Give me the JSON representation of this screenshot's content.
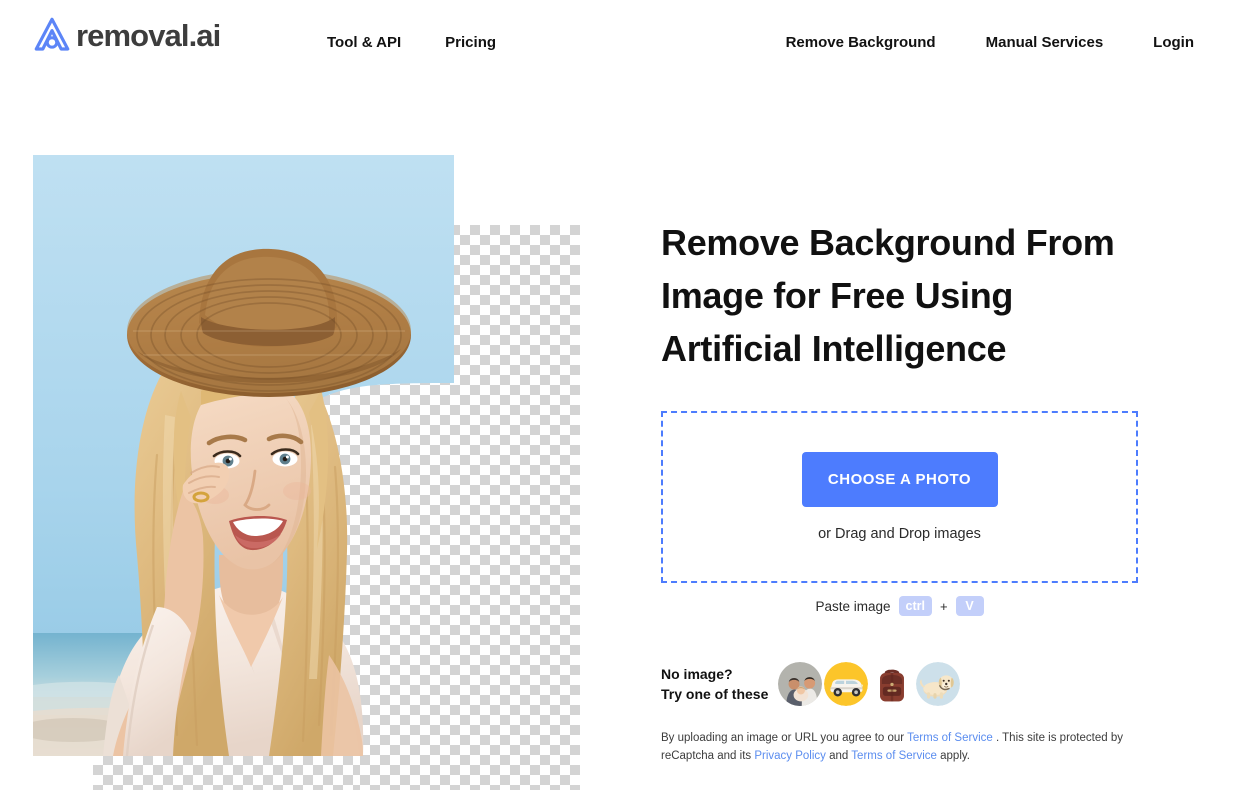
{
  "brand": {
    "name": "removal.ai",
    "logo_icon": "removal-ai-logo-icon",
    "logo_color": "#5c85f7",
    "text_color": "#3d3d3d"
  },
  "nav": {
    "left_items": [
      {
        "label": "Tool & API",
        "name": "nav-tool-api"
      },
      {
        "label": "Pricing",
        "name": "nav-pricing"
      }
    ],
    "right_items": [
      {
        "label": "Remove Background",
        "name": "nav-remove-background"
      },
      {
        "label": "Manual Services",
        "name": "nav-manual-services"
      },
      {
        "label": "Login",
        "name": "nav-login"
      }
    ]
  },
  "hero": {
    "image_alt": "Blonde woman in straw hat at the beach with background partially removed",
    "transparency_checker": "checkerboard-transparency-pattern"
  },
  "main": {
    "headline": "Remove Background From Image for Free Using Artificial Intelligence",
    "dropzone": {
      "button_label": "CHOOSE A PHOTO",
      "drag_text": "or Drag and Drop images",
      "border_color": "#4d7cfe",
      "button_color": "#4d7cfe"
    },
    "paste": {
      "label": "Paste image",
      "key1": "ctrl",
      "separator": "+",
      "key2": "V",
      "key_bg": "#c3cffa"
    },
    "samples": {
      "label_line1": "No image?",
      "label_line2": "Try one of these",
      "thumbnails": [
        {
          "name": "sample-thumb-family",
          "alt": "family portrait"
        },
        {
          "name": "sample-thumb-car",
          "alt": "white classic car on yellow background"
        },
        {
          "name": "sample-thumb-backpack",
          "alt": "brown leather backpack"
        },
        {
          "name": "sample-thumb-dog",
          "alt": "golden retriever dog on light blue background"
        }
      ]
    },
    "legal": {
      "part1": "By uploading an image or URL you agree to our ",
      "link1": "Terms of Service",
      "part2": " . This site is protected by reCaptcha and its ",
      "link2": "Privacy Policy",
      "part3": " and ",
      "link3": "Terms of Service",
      "part4": " apply.",
      "link_color": "#5b8def"
    }
  }
}
